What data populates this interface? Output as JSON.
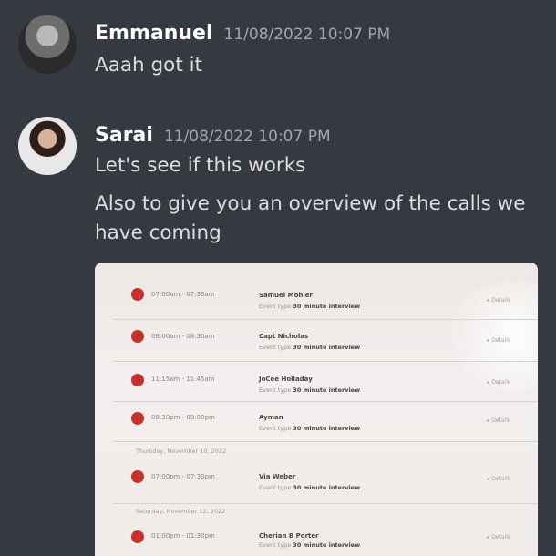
{
  "messages": [
    {
      "author": "Emmanuel",
      "timestamp": "11/08/2022 10:07 PM",
      "lines": [
        "Aaah got it"
      ]
    },
    {
      "author": "Sarai",
      "timestamp": "11/08/2022 10:07 PM",
      "lines": [
        "Let's see if this works",
        "Also to give you an overview of the calls we",
        "have coming"
      ]
    }
  ],
  "attachment": {
    "rows": [
      {
        "time": "07:00am - 07:30am",
        "name": "Samuel Mohler",
        "event_label": "Event type",
        "event_value": "30 minute interview",
        "details": "Details"
      },
      {
        "time": "08:00am - 08:30am",
        "name": "Capt Nicholas",
        "event_label": "Event type",
        "event_value": "30 minute interview",
        "details": "Details"
      },
      {
        "time": "11:15am - 11:45am",
        "name": "JoCee Holladay",
        "event_label": "Event type",
        "event_value": "30 minute interview",
        "details": "Details"
      },
      {
        "time": "08:30pm - 09:00pm",
        "name": "Ayman",
        "event_label": "Event type",
        "event_value": "30 minute interview",
        "details": "Details"
      },
      {
        "time": "07:00pm - 07:30pm",
        "name": "Via Weber",
        "event_label": "Event type",
        "event_value": "30 minute interview",
        "details": "Details"
      },
      {
        "time": "01:00pm - 01:30pm",
        "name": "Cherian B Porter",
        "event_label": "Event type",
        "event_value": "30 minute interview",
        "details": "Details"
      }
    ],
    "day_headers": [
      "Thursday, November 10, 2022",
      "Saturday, November 12, 2022"
    ]
  }
}
